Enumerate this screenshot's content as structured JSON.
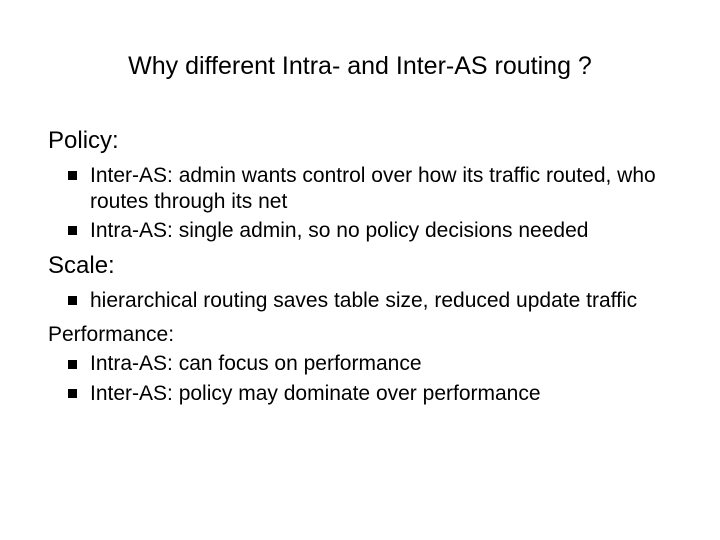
{
  "title": "Why different Intra- and Inter-AS routing ?",
  "sections": [
    {
      "heading": "Policy:",
      "bullets": [
        "Inter-AS: admin wants control over how its traffic routed, who routes through its net",
        "Intra-AS: single admin, so no policy decisions needed"
      ]
    },
    {
      "heading": "Scale:",
      "bullets": [
        "hierarchical routing saves table size, reduced update traffic"
      ]
    }
  ],
  "subhead": "Performance:",
  "perf_bullets": [
    "Intra-AS: can focus on performance",
    "Inter-AS: policy may dominate over performance"
  ]
}
